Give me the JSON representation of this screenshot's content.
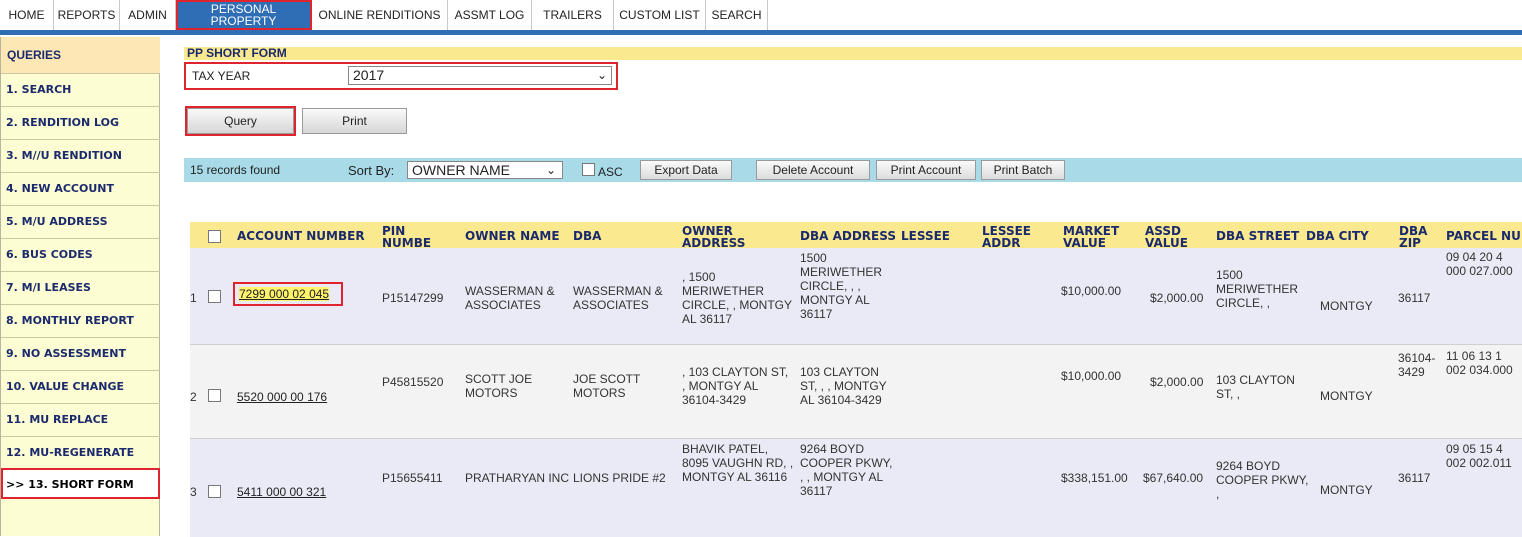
{
  "nav": {
    "tabs": [
      "HOME",
      "REPORTS",
      "ADMIN",
      "PERSONAL PROPERTY",
      "ONLINE RENDITIONS",
      "ASSMT LOG",
      "TRAILERS",
      "CUSTOM LIST",
      "SEARCH"
    ],
    "active_line1": "PERSONAL",
    "active_line2": "PROPERTY"
  },
  "sidebar": {
    "title": "QUERIES",
    "items": [
      "1. SEARCH",
      "2. RENDITION LOG",
      "3. M//U RENDITION",
      "4. NEW ACCOUNT",
      "5. M/U ADDRESS",
      "6. BUS CODES",
      "7. M/I LEASES",
      "8. MONTHLY REPORT",
      "9. NO ASSESSMENT",
      "10. VALUE CHANGE",
      "11. MU REPLACE",
      "12. MU-REGENERATE",
      ">> 13. SHORT FORM"
    ]
  },
  "form": {
    "title": "PP SHORT FORM",
    "tax_year_label": "TAX YEAR",
    "tax_year_value": "2017",
    "query_label": "Query",
    "print_label": "Print"
  },
  "toolbar": {
    "records_found": "15 records found",
    "sort_by_label": "Sort By:",
    "sort_by_value": "OWNER NAME",
    "asc_label": "ASC",
    "export_label": "Export Data",
    "delete_label": "Delete Account",
    "print_account_label": "Print Account",
    "print_batch_label": "Print Batch"
  },
  "table": {
    "headers": {
      "account_number": "ACCOUNT NUMBER",
      "pin_number": "PIN NUMBER",
      "owner_name": "OWNER NAME",
      "dba": "DBA",
      "owner_address": "OWNER ADDRESS",
      "dba_address": "DBA ADDRESS",
      "lessee": "LESSEE",
      "lessee_addr": "LESSEE ADDR",
      "market_value": "MARKET VALUE",
      "assd_value": "ASSD VALUE",
      "dba_street": "DBA STREET",
      "dba_city": "DBA CITY",
      "dba_zip": "DBA ZIP",
      "parcel_number": "PARCEL NU"
    },
    "rows": [
      {
        "n": "1",
        "account": "7299 000 02 045",
        "pin": "P15147299",
        "owner": "WASSERMAN & ASSOCIATES",
        "dba": "WASSERMAN & ASSOCIATES",
        "owner_address": ", 1500 MERIWETHER CIRCLE, , MONTGY AL 36117",
        "dba_address": "1500 MERIWETHER CIRCLE, , , MONTGY AL 36117",
        "market": "$10,000.00",
        "assd": "$2,000.00",
        "dba_street": "1500 MERIWETHER CIRCLE, ,",
        "dba_city": "MONTGY",
        "dba_zip": "36117",
        "parcel": "09 04 20 4 000 027.000"
      },
      {
        "n": "2",
        "account": "5520 000 00 176",
        "pin": "P45815520",
        "owner": "SCOTT JOE MOTORS",
        "dba": "JOE SCOTT MOTORS",
        "owner_address": ", 103 CLAYTON ST, , MONTGY AL 36104-3429",
        "dba_address": "103 CLAYTON ST, , , MONTGY AL 36104-3429",
        "market": "$10,000.00",
        "assd": "$2,000.00",
        "dba_street": "103 CLAYTON ST, ,",
        "dba_city": "MONTGY",
        "dba_zip": "36104-3429",
        "parcel": "11 06 13 1 002 034.000"
      },
      {
        "n": "3",
        "account": "5411 000 00 321",
        "pin": "P15655411",
        "owner": "PRATHARYAN INC",
        "dba": "LIONS PRIDE #2",
        "owner_address": "BHAVIK PATEL, 8095 VAUGHN RD, , MONTGY AL 36116",
        "dba_address": "9264 BOYD COOPER PKWY, , , MONTGY AL 36117",
        "market": "$338,151.00",
        "assd": "$67,640.00",
        "dba_street": "9264 BOYD COOPER PKWY, ,",
        "dba_city": "MONTGY",
        "dba_zip": "36117",
        "parcel": "09 05 15 4 002 002.011"
      }
    ]
  }
}
